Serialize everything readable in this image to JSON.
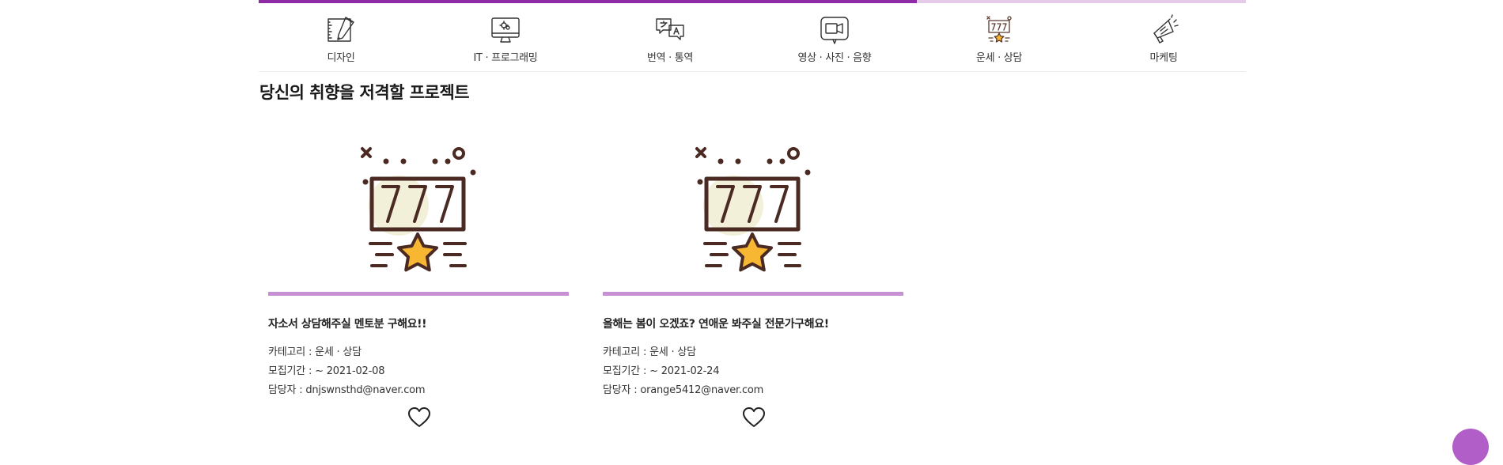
{
  "progress": {
    "filled_fraction": 0.667,
    "fill_color": "#8e2aa6",
    "track_color": "#e4cbe8"
  },
  "categories": [
    {
      "label": "디자인",
      "icon": "design-tools-icon"
    },
    {
      "label": "IT · 프로그래밍",
      "icon": "computer-monitor-icon"
    },
    {
      "label": "번역 · 통역",
      "icon": "translation-speech-bubbles-icon"
    },
    {
      "label": "영상 · 사진 · 음향",
      "icon": "video-camera-icon"
    },
    {
      "label": "운세 · 상담",
      "icon": "slot-machine-icon"
    },
    {
      "label": "마케팅",
      "icon": "megaphone-icon"
    }
  ],
  "section": {
    "title": "당신의 취향을 저격할 프로젝트"
  },
  "projects": [
    {
      "title": "자소서 상담해주실 멘토분 구해요!!",
      "category": "카테고리 : 운세 · 상담",
      "period": "모집기간 : ~ 2021-02-08",
      "manager": "담당자 : dnjswnsthd@naver.com",
      "image_icon": "slot-machine-777-icon"
    },
    {
      "title": "올해는 봄이 오겠죠? 연애운 봐주실 전문가구해요!",
      "category": "카테고리 : 운세 · 상담",
      "period": "모집기간 : ~ 2021-02-24",
      "manager": "담당자 : orange5412@naver.com",
      "image_icon": "slot-machine-777-icon"
    }
  ],
  "colors": {
    "accent": "#c790d3",
    "float_button": "#b25ec9",
    "star": "#f7b733",
    "line_art": "#4a2a22"
  }
}
